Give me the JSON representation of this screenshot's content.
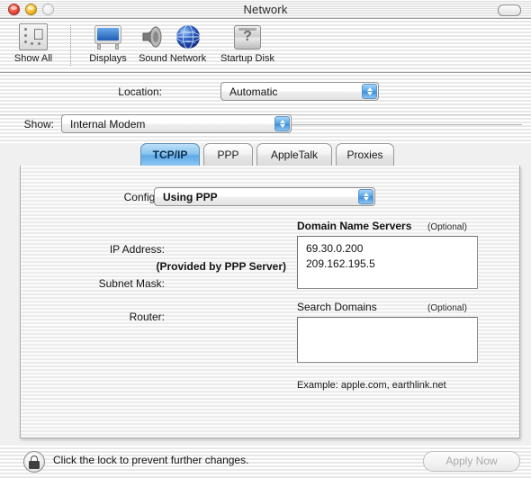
{
  "window": {
    "title": "Network",
    "controls": {
      "close": "close-button",
      "minimize": "minimize-button",
      "zoom": "zoom-button",
      "toolbar_toggle": "toolbar-toggle-button"
    }
  },
  "toolbar": {
    "items": [
      {
        "label": "Show All",
        "icon": "show-all-icon"
      },
      {
        "label": "Displays",
        "icon": "displays-icon"
      },
      {
        "label": "Sound",
        "icon": "sound-icon"
      },
      {
        "label": "Network",
        "icon": "network-icon"
      },
      {
        "label": "Startup Disk",
        "icon": "startup-disk-icon"
      }
    ]
  },
  "form": {
    "location_label": "Location:",
    "location_value": "Automatic",
    "show_label": "Show:",
    "show_value": "Internal Modem"
  },
  "tabs": [
    {
      "label": "TCP/IP",
      "active": true
    },
    {
      "label": "PPP",
      "active": false
    },
    {
      "label": "AppleTalk",
      "active": false
    },
    {
      "label": "Proxies",
      "active": false
    }
  ],
  "tcpip": {
    "configure_label": "Configure:",
    "configure_value": "Using PPP",
    "ip_address_label": "IP Address:",
    "ip_address_note": "(Provided by PPP Server)",
    "subnet_mask_label": "Subnet Mask:",
    "router_label": "Router:",
    "dns": {
      "title": "Domain Name Servers",
      "optional": "(Optional)",
      "values": "69.30.0.200\n209.162.195.5"
    },
    "search_domains": {
      "title": "Search Domains",
      "optional": "(Optional)",
      "values": "",
      "example": "Example: apple.com, earthlink.net"
    }
  },
  "bottom": {
    "lock_icon": "lock-closed-icon",
    "lock_text": "Click the lock to prevent further changes.",
    "apply_label": "Apply Now"
  },
  "colors": {
    "accent": "#4d95d6",
    "tab_active": "#89c4f0",
    "popup_arrow": "#5ba7e6"
  }
}
